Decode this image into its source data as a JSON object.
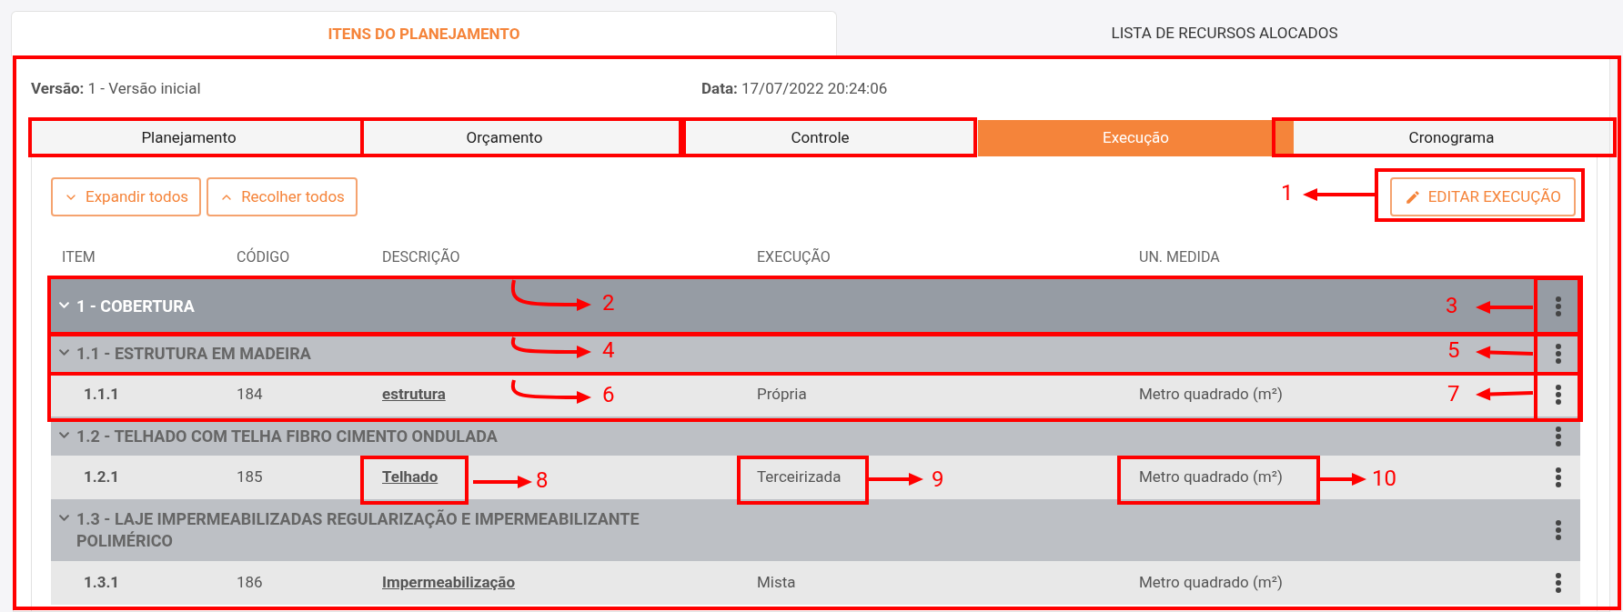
{
  "top_tabs": [
    {
      "label": "ITENS DO PLANEJAMENTO",
      "selected": true
    },
    {
      "label": "LISTA DE RECURSOS ALOCADOS",
      "selected": false
    }
  ],
  "version": {
    "label": "Versão:",
    "value": "1 - Versão inicial"
  },
  "date": {
    "label": "Data:",
    "value": "17/07/2022 20:24:06"
  },
  "sub_tabs": [
    {
      "label": "Planejamento",
      "selected": false
    },
    {
      "label": "Orçamento",
      "selected": false
    },
    {
      "label": "Controle",
      "selected": false
    },
    {
      "label": "Execução",
      "selected": true
    },
    {
      "label": "Cronograma",
      "selected": false
    }
  ],
  "buttons": [
    {
      "label": "Expandir todos",
      "kind": "expand"
    },
    {
      "label": "Recolher todos",
      "kind": "collapse"
    }
  ],
  "edit_button": "EDITAR EXECUÇÃO",
  "table": {
    "columns": [
      "ITEM",
      "CÓDIGO",
      "DESCRIÇÃO",
      "EXECUÇÃO",
      "UN. MEDIDA"
    ],
    "rows": [
      {
        "label": "1 - COBERTURA",
        "expanded": true,
        "children": [
          {
            "label": "1.1 - ESTRUTURA EM MADEIRA",
            "expanded": true,
            "children": [
              {
                "item": "1.1.1",
                "code": "184",
                "description": "estrutura",
                "execution": "Própria",
                "unit": "Metro quadrado (m²)"
              }
            ]
          },
          {
            "label": "1.2 - TELHADO COM TELHA FIBRO CIMENTO ONDULADA",
            "expanded": true,
            "children": [
              {
                "item": "1.2.1",
                "code": "185",
                "description": "Telhado",
                "execution": "Terceirizada",
                "unit": "Metro quadrado (m²)"
              }
            ]
          },
          {
            "label": "1.3 - LAJE IMPERMEABILIZADAS REGULARIZAÇÃO E IMPERMEABILIZANTE POLIMÉRICO",
            "expanded": true,
            "children": [
              {
                "item": "1.3.1",
                "code": "186",
                "description": "Impermeabilização",
                "execution": "Mista",
                "unit": "Metro quadrado (m²)"
              }
            ]
          }
        ]
      }
    ]
  },
  "annotations": [
    {
      "label": "1"
    },
    {
      "label": "2"
    },
    {
      "label": "3"
    },
    {
      "label": "4"
    },
    {
      "label": "5"
    },
    {
      "label": "6"
    },
    {
      "label": "7"
    },
    {
      "label": "8"
    },
    {
      "label": "9"
    },
    {
      "label": "10"
    }
  ]
}
